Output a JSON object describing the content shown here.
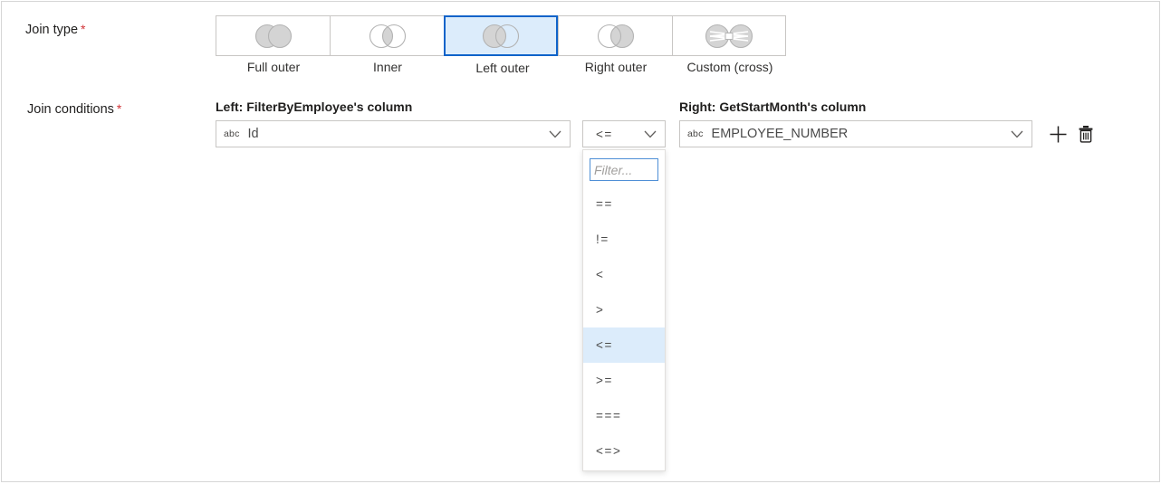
{
  "form": {
    "join_type_label": "Join type",
    "join_conditions_label": "Join conditions",
    "required_mark": "*"
  },
  "join_type": {
    "selected": "Left outer",
    "options": [
      {
        "label": "Full outer",
        "icon": "venn-full-outer-icon",
        "selected": false
      },
      {
        "label": "Inner",
        "icon": "venn-inner-icon",
        "selected": false
      },
      {
        "label": "Left outer",
        "icon": "venn-left-outer-icon",
        "selected": true
      },
      {
        "label": "Right outer",
        "icon": "venn-right-outer-icon",
        "selected": false
      },
      {
        "label": "Custom (cross)",
        "icon": "venn-custom-cross-icon",
        "selected": false
      }
    ]
  },
  "join_conditions": {
    "left": {
      "heading": "Left: FilterByEmployee's column",
      "type_icon": "abc",
      "value": "Id"
    },
    "right": {
      "heading": "Right: GetStartMonth's column",
      "type_icon": "abc",
      "value": "EMPLOYEE_NUMBER"
    },
    "operator": {
      "value": "<=",
      "expanded": true,
      "filter_placeholder": "Filter...",
      "filter_value": "",
      "options": [
        {
          "label": "==",
          "selected": false
        },
        {
          "label": "!=",
          "selected": false
        },
        {
          "label": "<",
          "selected": false
        },
        {
          "label": ">",
          "selected": false
        },
        {
          "label": "<=",
          "selected": true
        },
        {
          "label": ">=",
          "selected": false
        },
        {
          "label": "===",
          "selected": false
        },
        {
          "label": "<=>",
          "selected": false
        }
      ]
    },
    "actions": {
      "add_icon": "plus-icon",
      "delete_icon": "trash-icon"
    }
  },
  "colors": {
    "accent": "#0f63c9",
    "accent_fill": "#dcecfb",
    "required": "#d13438",
    "border": "#c8c6c4",
    "venn_fill": "#d4d4d4",
    "venn_stroke": "#b3b3b3"
  }
}
